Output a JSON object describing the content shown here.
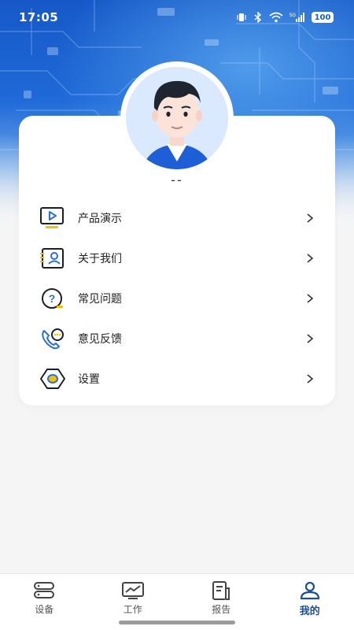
{
  "status_bar": {
    "time": "17:05",
    "battery": "100",
    "icons": [
      "vibrate-icon",
      "bluetooth-icon",
      "wifi-icon",
      "signal-5g-icon",
      "battery-icon"
    ]
  },
  "profile": {
    "username": "--"
  },
  "menu": {
    "items": [
      {
        "label": "产品演示",
        "icon": "video-play-icon"
      },
      {
        "label": "关于我们",
        "icon": "contact-card-icon"
      },
      {
        "label": "常见问题",
        "icon": "question-icon"
      },
      {
        "label": "意见反馈",
        "icon": "phone-chat-icon"
      },
      {
        "label": "设置",
        "icon": "settings-hexagon-icon"
      }
    ]
  },
  "bottom_nav": {
    "items": [
      {
        "label": "设备",
        "icon": "device-icon"
      },
      {
        "label": "工作",
        "icon": "chart-monitor-icon"
      },
      {
        "label": "报告",
        "icon": "report-icon"
      },
      {
        "label": "我的",
        "icon": "user-icon"
      }
    ],
    "active_index": 3
  },
  "colors": {
    "accent": "#1b4e9b",
    "hero_blue": "#1f6ad8",
    "icon_yellow": "#f2c200",
    "icon_blue": "#2a6fd6"
  }
}
